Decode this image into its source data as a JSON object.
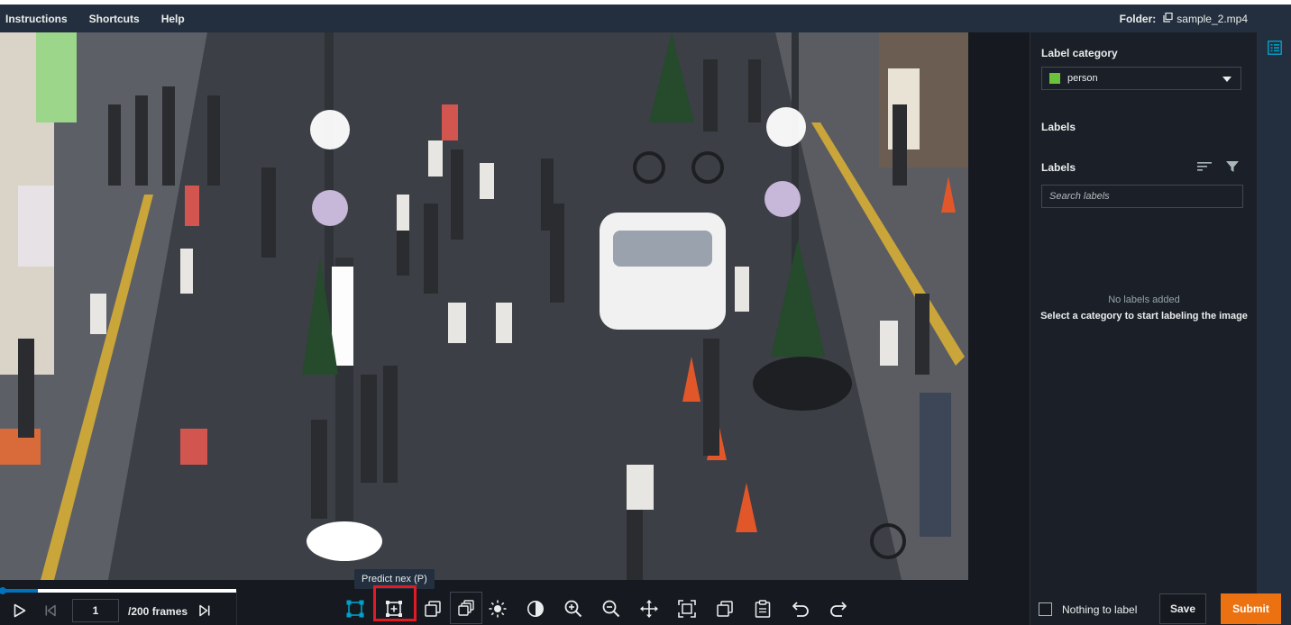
{
  "menu": {
    "instructions": "Instructions",
    "shortcuts": "Shortcuts",
    "help": "Help"
  },
  "folder": {
    "label": "Folder:",
    "name": "sample_2.mp4"
  },
  "panel": {
    "label_category_heading": "Label category",
    "category_value": "person",
    "category_color": "#6bc23b",
    "labels_heading_1": "Labels",
    "labels_heading_2": "Labels",
    "search_placeholder": "Search labels",
    "empty_title": "No labels added",
    "empty_subtitle": "Select a category to start labeling the image"
  },
  "player": {
    "current_frame": "1",
    "total_frames": "/200 frames",
    "progress_fraction": 0.005
  },
  "tooltip": {
    "text": "Predict nex  (P)"
  },
  "toolbar": {
    "icons": [
      "play-icon",
      "skip-to-start-icon",
      "skip-to-end-icon",
      "bounding-box-icon",
      "predict-next-icon",
      "copy-to-next-icon",
      "copy-to-all-icon",
      "brightness-icon",
      "contrast-icon",
      "zoom-in-icon",
      "zoom-out-icon",
      "move-icon",
      "fit-screen-icon",
      "copy-icon",
      "paste-icon",
      "undo-icon",
      "redo-icon"
    ]
  },
  "actions": {
    "nothing_to_label": "Nothing to label",
    "save": "Save",
    "submit": "Submit"
  },
  "colors": {
    "accent": "#0073bb",
    "submit": "#ec7211",
    "highlight": "#e01b24"
  }
}
